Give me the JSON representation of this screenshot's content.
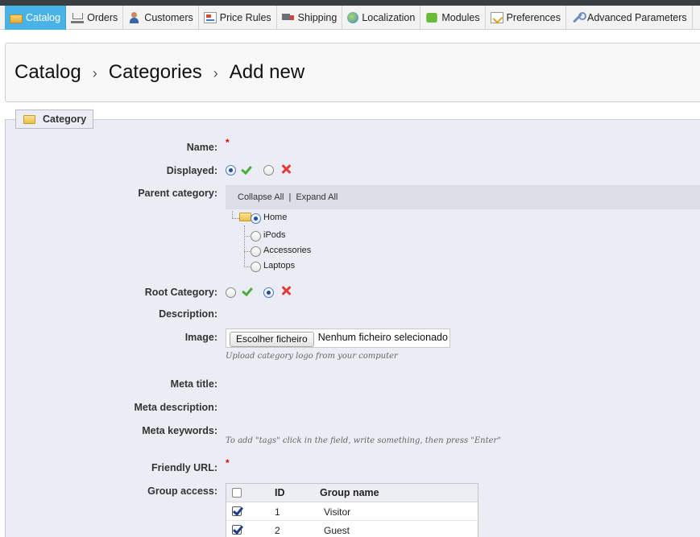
{
  "nav": {
    "tabs": [
      {
        "label": "Catalog",
        "icon": "catalog-folder-icon",
        "active": true
      },
      {
        "label": "Orders",
        "icon": "cart-icon",
        "active": false
      },
      {
        "label": "Customers",
        "icon": "customer-icon",
        "active": false
      },
      {
        "label": "Price Rules",
        "icon": "price-tag-icon",
        "active": false
      },
      {
        "label": "Shipping",
        "icon": "truck-icon",
        "active": false
      },
      {
        "label": "Localization",
        "icon": "globe-icon",
        "active": false
      },
      {
        "label": "Modules",
        "icon": "puzzle-icon",
        "active": false
      },
      {
        "label": "Preferences",
        "icon": "preferences-icon",
        "active": false
      },
      {
        "label": "Advanced Parameters",
        "icon": "wrench-icon",
        "active": false
      }
    ],
    "accent_color": "#49b2e6"
  },
  "breadcrumb": {
    "items": [
      "Catalog",
      "Categories",
      "Add new"
    ],
    "separator": "›"
  },
  "form": {
    "legend": "Category",
    "labels": {
      "name": "Name:",
      "displayed": "Displayed:",
      "parent_category": "Parent category:",
      "root_category": "Root Category:",
      "description": "Description:",
      "image": "Image:",
      "meta_title": "Meta title:",
      "meta_description": "Meta description:",
      "meta_keywords": "Meta keywords:",
      "friendly_url": "Friendly URL:",
      "group_access": "Group access:"
    },
    "required_mark": "*",
    "displayed_value": "yes",
    "root_category_value": "no",
    "tree": {
      "collapse_all": "Collapse All",
      "separator": "|",
      "expand_all": "Expand All",
      "root": {
        "label": "Home",
        "selected": true
      },
      "children": [
        {
          "label": "iPods",
          "selected": false
        },
        {
          "label": "Accessories",
          "selected": false
        },
        {
          "label": "Laptops",
          "selected": false
        }
      ]
    },
    "image": {
      "button_label": "Escolher ficheiro",
      "status": "Nenhum ficheiro selecionado",
      "hint": "Upload category logo from your computer"
    },
    "meta_keywords_hint": "To add \"tags\" click in the field, write something, then press \"Enter\"",
    "group_table": {
      "columns": [
        "ID",
        "Group name"
      ],
      "select_all": false,
      "rows": [
        {
          "id": "1",
          "name": "Visitor",
          "checked": true
        },
        {
          "id": "2",
          "name": "Guest",
          "checked": true
        }
      ]
    }
  }
}
